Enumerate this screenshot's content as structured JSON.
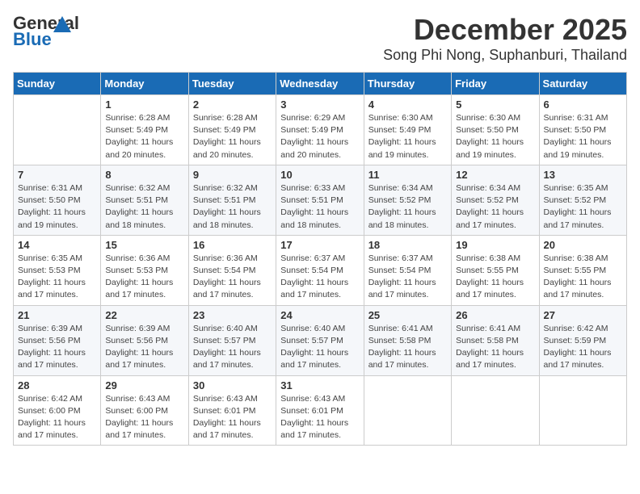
{
  "header": {
    "logo_general": "General",
    "logo_blue": "Blue",
    "month": "December 2025",
    "location": "Song Phi Nong, Suphanburi, Thailand"
  },
  "weekdays": [
    "Sunday",
    "Monday",
    "Tuesday",
    "Wednesday",
    "Thursday",
    "Friday",
    "Saturday"
  ],
  "weeks": [
    [
      {
        "day": "",
        "info": ""
      },
      {
        "day": "1",
        "info": "Sunrise: 6:28 AM\nSunset: 5:49 PM\nDaylight: 11 hours\nand 20 minutes."
      },
      {
        "day": "2",
        "info": "Sunrise: 6:28 AM\nSunset: 5:49 PM\nDaylight: 11 hours\nand 20 minutes."
      },
      {
        "day": "3",
        "info": "Sunrise: 6:29 AM\nSunset: 5:49 PM\nDaylight: 11 hours\nand 20 minutes."
      },
      {
        "day": "4",
        "info": "Sunrise: 6:30 AM\nSunset: 5:49 PM\nDaylight: 11 hours\nand 19 minutes."
      },
      {
        "day": "5",
        "info": "Sunrise: 6:30 AM\nSunset: 5:50 PM\nDaylight: 11 hours\nand 19 minutes."
      },
      {
        "day": "6",
        "info": "Sunrise: 6:31 AM\nSunset: 5:50 PM\nDaylight: 11 hours\nand 19 minutes."
      }
    ],
    [
      {
        "day": "7",
        "info": "Sunrise: 6:31 AM\nSunset: 5:50 PM\nDaylight: 11 hours\nand 19 minutes."
      },
      {
        "day": "8",
        "info": "Sunrise: 6:32 AM\nSunset: 5:51 PM\nDaylight: 11 hours\nand 18 minutes."
      },
      {
        "day": "9",
        "info": "Sunrise: 6:32 AM\nSunset: 5:51 PM\nDaylight: 11 hours\nand 18 minutes."
      },
      {
        "day": "10",
        "info": "Sunrise: 6:33 AM\nSunset: 5:51 PM\nDaylight: 11 hours\nand 18 minutes."
      },
      {
        "day": "11",
        "info": "Sunrise: 6:34 AM\nSunset: 5:52 PM\nDaylight: 11 hours\nand 18 minutes."
      },
      {
        "day": "12",
        "info": "Sunrise: 6:34 AM\nSunset: 5:52 PM\nDaylight: 11 hours\nand 17 minutes."
      },
      {
        "day": "13",
        "info": "Sunrise: 6:35 AM\nSunset: 5:52 PM\nDaylight: 11 hours\nand 17 minutes."
      }
    ],
    [
      {
        "day": "14",
        "info": "Sunrise: 6:35 AM\nSunset: 5:53 PM\nDaylight: 11 hours\nand 17 minutes."
      },
      {
        "day": "15",
        "info": "Sunrise: 6:36 AM\nSunset: 5:53 PM\nDaylight: 11 hours\nand 17 minutes."
      },
      {
        "day": "16",
        "info": "Sunrise: 6:36 AM\nSunset: 5:54 PM\nDaylight: 11 hours\nand 17 minutes."
      },
      {
        "day": "17",
        "info": "Sunrise: 6:37 AM\nSunset: 5:54 PM\nDaylight: 11 hours\nand 17 minutes."
      },
      {
        "day": "18",
        "info": "Sunrise: 6:37 AM\nSunset: 5:54 PM\nDaylight: 11 hours\nand 17 minutes."
      },
      {
        "day": "19",
        "info": "Sunrise: 6:38 AM\nSunset: 5:55 PM\nDaylight: 11 hours\nand 17 minutes."
      },
      {
        "day": "20",
        "info": "Sunrise: 6:38 AM\nSunset: 5:55 PM\nDaylight: 11 hours\nand 17 minutes."
      }
    ],
    [
      {
        "day": "21",
        "info": "Sunrise: 6:39 AM\nSunset: 5:56 PM\nDaylight: 11 hours\nand 17 minutes."
      },
      {
        "day": "22",
        "info": "Sunrise: 6:39 AM\nSunset: 5:56 PM\nDaylight: 11 hours\nand 17 minutes."
      },
      {
        "day": "23",
        "info": "Sunrise: 6:40 AM\nSunset: 5:57 PM\nDaylight: 11 hours\nand 17 minutes."
      },
      {
        "day": "24",
        "info": "Sunrise: 6:40 AM\nSunset: 5:57 PM\nDaylight: 11 hours\nand 17 minutes."
      },
      {
        "day": "25",
        "info": "Sunrise: 6:41 AM\nSunset: 5:58 PM\nDaylight: 11 hours\nand 17 minutes."
      },
      {
        "day": "26",
        "info": "Sunrise: 6:41 AM\nSunset: 5:58 PM\nDaylight: 11 hours\nand 17 minutes."
      },
      {
        "day": "27",
        "info": "Sunrise: 6:42 AM\nSunset: 5:59 PM\nDaylight: 11 hours\nand 17 minutes."
      }
    ],
    [
      {
        "day": "28",
        "info": "Sunrise: 6:42 AM\nSunset: 6:00 PM\nDaylight: 11 hours\nand 17 minutes."
      },
      {
        "day": "29",
        "info": "Sunrise: 6:43 AM\nSunset: 6:00 PM\nDaylight: 11 hours\nand 17 minutes."
      },
      {
        "day": "30",
        "info": "Sunrise: 6:43 AM\nSunset: 6:01 PM\nDaylight: 11 hours\nand 17 minutes."
      },
      {
        "day": "31",
        "info": "Sunrise: 6:43 AM\nSunset: 6:01 PM\nDaylight: 11 hours\nand 17 minutes."
      },
      {
        "day": "",
        "info": ""
      },
      {
        "day": "",
        "info": ""
      },
      {
        "day": "",
        "info": ""
      }
    ]
  ]
}
